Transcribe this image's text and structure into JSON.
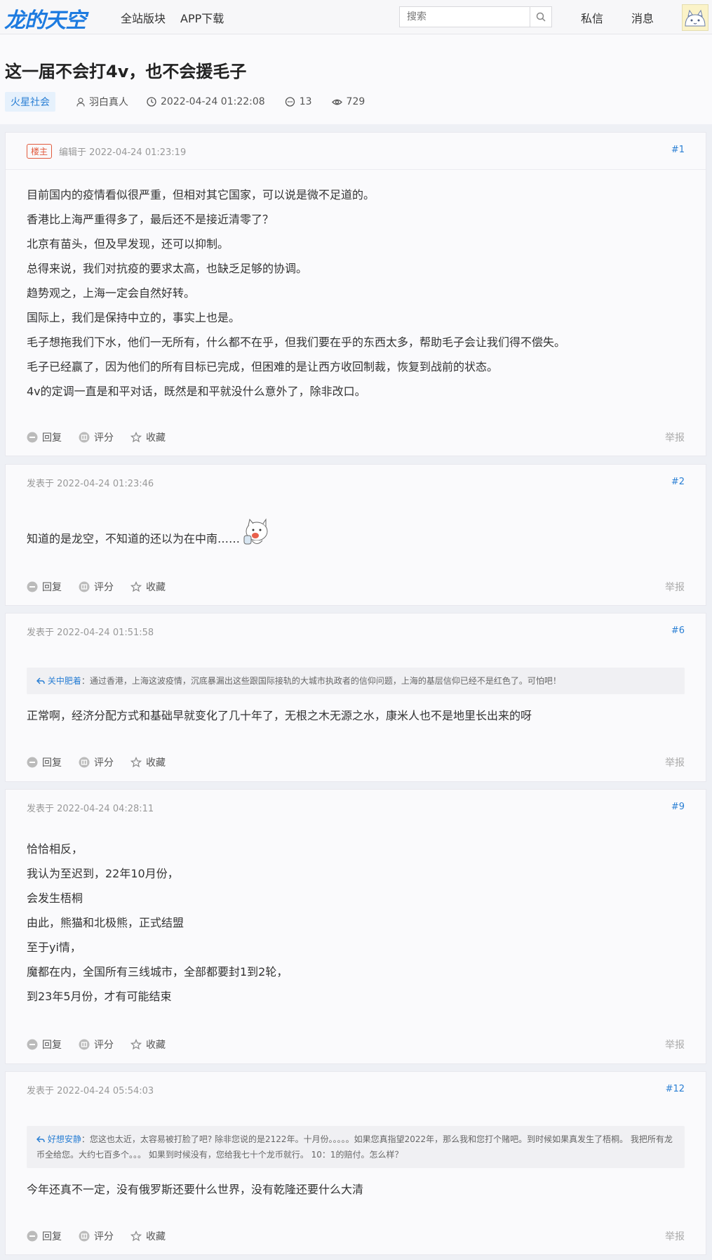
{
  "header": {
    "logo_text": "龙的天空",
    "nav": [
      "全站版块",
      "APP下载"
    ],
    "search_placeholder": "搜索",
    "messages_label": "私信",
    "notifications_label": "消息"
  },
  "thread": {
    "title": "这一届不会打4v，也不会援毛子",
    "forum": "火星社会",
    "author": "羽白真人",
    "datetime": "2022-04-24 01:22:08",
    "reply_count": "13",
    "view_count": "729"
  },
  "labels": {
    "reply": "回复",
    "rate": "评分",
    "favorite": "收藏",
    "report": "举报",
    "op_badge": "楼主"
  },
  "posts": [
    {
      "meta": "编辑于 2022-04-24 01:23:19",
      "floor": "#1",
      "lines": [
        "目前国内的疫情看似很严重，但相对其它国家，可以说是微不足道的。",
        "香港比上海严重得多了，最后还不是接近清零了？",
        "北京有苗头，但及早发现，还可以抑制。",
        "总得来说，我们对抗疫的要求太高，也缺乏足够的协调。",
        "趋势观之，上海一定会自然好转。",
        "国际上，我们是保持中立的，事实上也是。",
        "毛子想拖我们下水，他们一无所有，什么都不在乎，但我们要在乎的东西太多，帮助毛子会让我们得不偿失。",
        "毛子已经赢了，因为他们的所有目标已完成，但困难的是让西方收回制裁，恢复到战前的状态。",
        "4v的定调一直是和平对话，既然是和平就没什么意外了，除非改口。"
      ]
    },
    {
      "meta": "发表于 2022-04-24 01:23:46",
      "floor": "#2",
      "lines": [
        "知道的是龙空，不知道的还以为在中南……"
      ]
    },
    {
      "meta": "发表于 2022-04-24 01:51:58",
      "floor": "#6",
      "quote_author": "关中肥着",
      "quote_text": "：通过香港，上海这波疫情，沉底暴漏出这些跟国际接轨的大城市执政者的信仰问题，上海的基层信仰已经不是红色了。可怕吧！",
      "lines": [
        "正常啊，经济分配方式和基础早就变化了几十年了，无根之木无源之水，康米人也不是地里长出来的呀"
      ]
    },
    {
      "meta": "发表于 2022-04-24 04:28:11",
      "floor": "#9",
      "lines": [
        "恰恰相反，",
        "我认为至迟到，22年10月份，",
        "会发生梧桐",
        "由此，熊猫和北极熊，正式结盟",
        "至于yi情，",
        "魔都在内，全国所有三线城市，全部都要封1到2轮，",
        "到23年5月份，才有可能结束"
      ]
    },
    {
      "meta": "发表于 2022-04-24 05:54:03",
      "floor": "#12",
      "quote_author": "好想安静",
      "quote_text": "：您这也太近，太容易被打脸了吧? 除非您说的是2122年。十月份。。。。。如果您真指望2022年，那么我和您打个赌吧。到时候如果真发生了梧桐。 我把所有龙币全给您。大约七百多个。。。 如果到时候没有，您给我七十个龙币就行。 10：1的赔付。怎么样？",
      "lines": [
        "今年还真不一定，没有俄罗斯还要什么世界，没有乾隆还要什么大清"
      ]
    }
  ],
  "colors": {
    "brand": "#1d7be0",
    "op_badge": "#e25a3c",
    "link": "#2a7fd4"
  }
}
